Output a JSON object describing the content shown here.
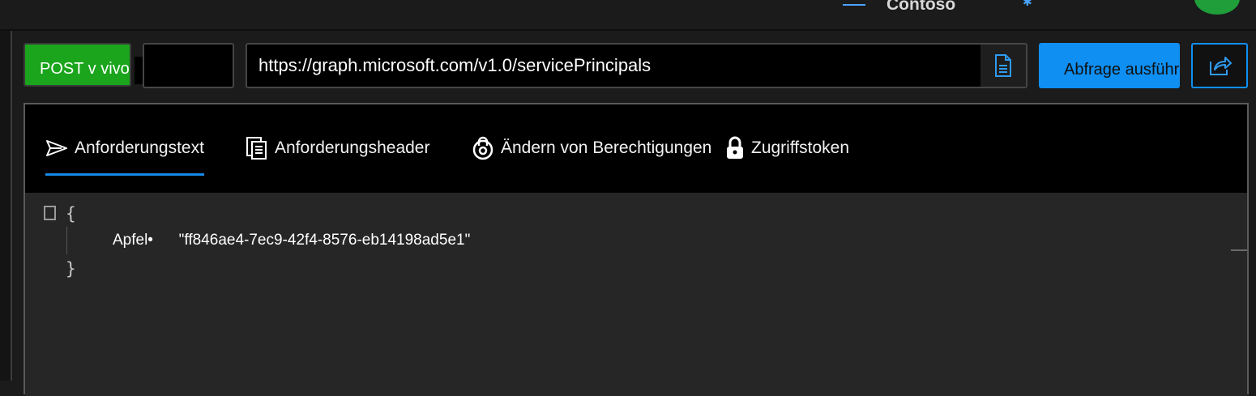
{
  "header": {
    "tenant_name": "Contoso"
  },
  "request_bar": {
    "method_label": "POST v vivo",
    "version_value": "",
    "url": "https://graph.microsoft.com/v1.0/servicePrincipals",
    "run_button_label": "Abfrage ausführen"
  },
  "tabs": [
    {
      "label": "Anforderungstext",
      "icon": "send-icon",
      "selected": true
    },
    {
      "label": "Anforderungsheader",
      "icon": "request-header-icon",
      "selected": false
    },
    {
      "label": "Ändern von Berechtigungen",
      "icon": "permissions-icon",
      "selected": false
    },
    {
      "label": "Zugriffstoken",
      "icon": "lock-icon",
      "selected": false
    }
  ],
  "editor": {
    "open_brace": "{",
    "close_brace": "}",
    "line_key": "Apfel•",
    "line_value": "\"ff846ae4-7ec9-42f4-8576-eb14198ad5e1\""
  },
  "colors": {
    "method_bg": "#1aa51c",
    "run_bg": "#0f8ff2",
    "tab_underline": "#1688e6"
  }
}
